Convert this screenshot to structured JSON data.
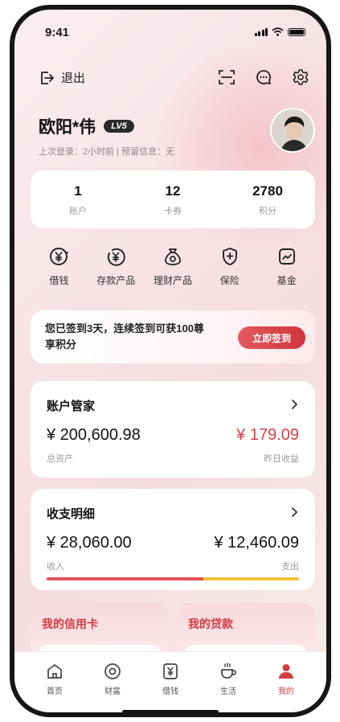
{
  "status_bar": {
    "time": "9:41"
  },
  "header": {
    "logout_label": "退出"
  },
  "profile": {
    "name": "欧阳*伟",
    "level": "LV5",
    "last_login": "上次登录：2小时前 | 预留信息：无"
  },
  "stats": [
    {
      "value": "1",
      "label": "账户"
    },
    {
      "value": "12",
      "label": "卡券"
    },
    {
      "value": "2780",
      "label": "积分"
    }
  ],
  "shortcuts": [
    {
      "label": "借钱",
      "icon": "yen-coin-icon"
    },
    {
      "label": "存款产品",
      "icon": "deposit-icon"
    },
    {
      "label": "理财产品",
      "icon": "money-bag-icon"
    },
    {
      "label": "保险",
      "icon": "shield-icon"
    },
    {
      "label": "基金",
      "icon": "chart-icon"
    }
  ],
  "signin": {
    "text": "您已签到3天，连续签到可获100尊享积分",
    "button": "立即签到"
  },
  "asset_card": {
    "title": "账户管家",
    "total_value": "¥ 200,600.98",
    "total_label": "总资产",
    "yesterday_value": "¥ 179.09",
    "yesterday_label": "昨日收益",
    "accent_color": "#d8404a"
  },
  "flow_card": {
    "title": "收支明细",
    "income_value": "¥ 28,060.00",
    "income_label": "收入",
    "expense_value": "¥ 12,460.09",
    "expense_label": "支出",
    "income_share": 0.62,
    "income_color": "#e2525a",
    "expense_color": "#f2c23b"
  },
  "mini_cards": [
    {
      "title": "我的信用卡"
    },
    {
      "title": "我的贷款"
    }
  ],
  "tabbar": [
    {
      "label": "首页",
      "icon": "home-icon"
    },
    {
      "label": "财富",
      "icon": "wealth-icon"
    },
    {
      "label": "借钱",
      "icon": "loan-icon"
    },
    {
      "label": "生活",
      "icon": "coffee-icon"
    },
    {
      "label": "我的",
      "icon": "user-icon",
      "active": true
    }
  ]
}
